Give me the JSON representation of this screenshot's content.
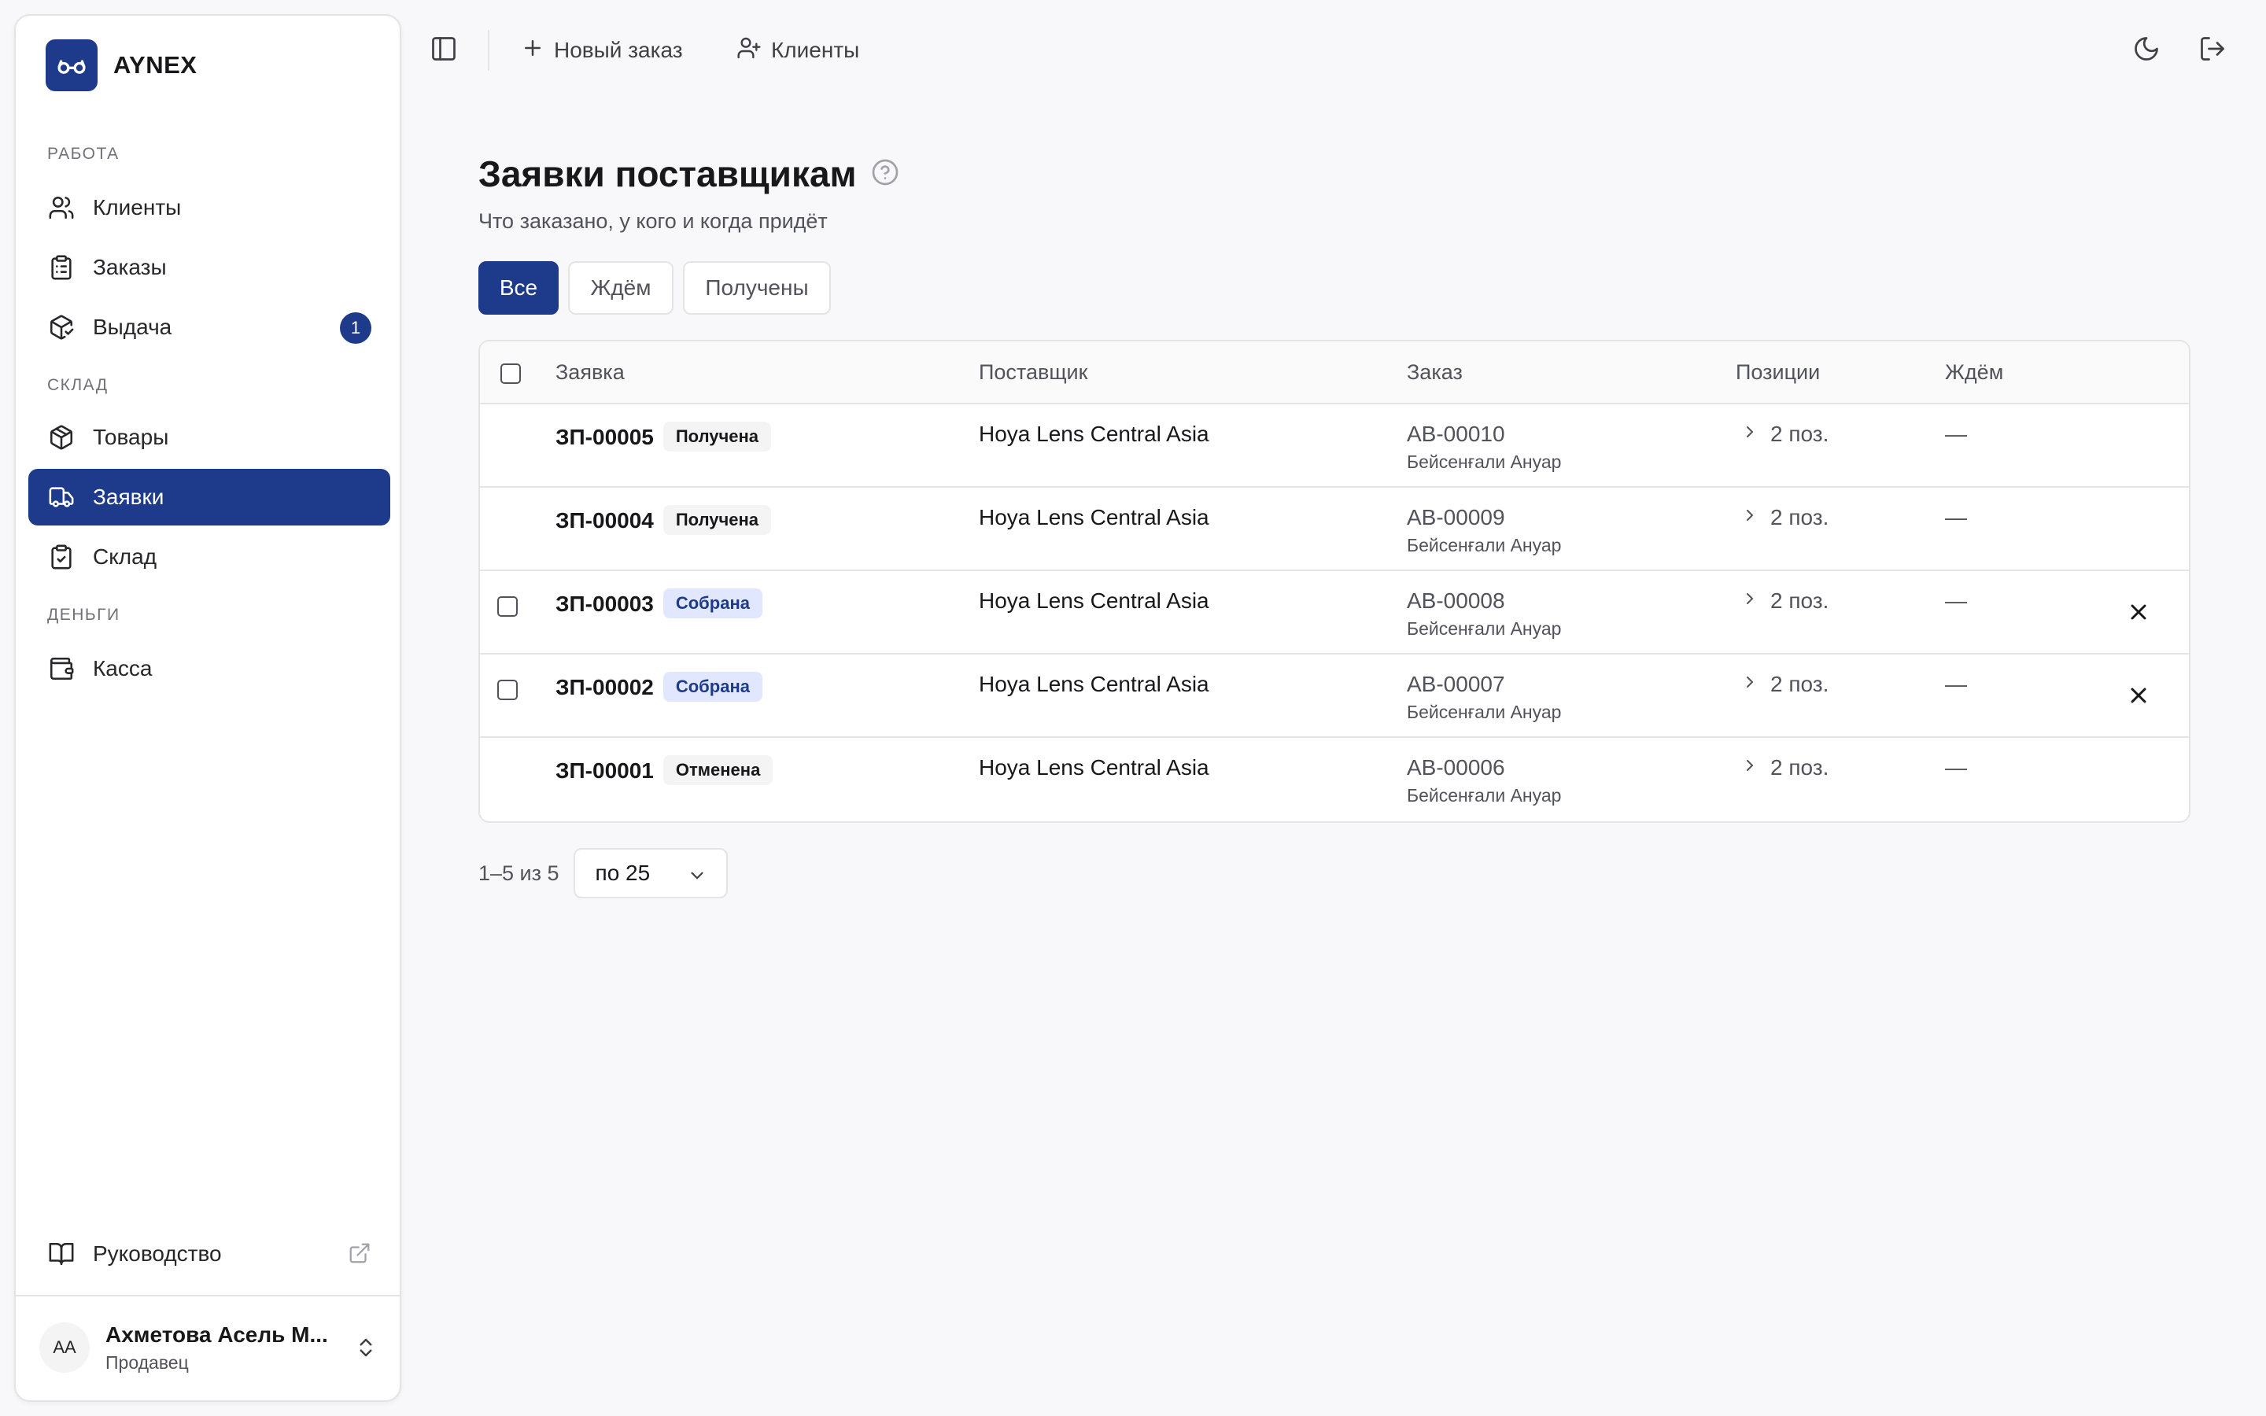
{
  "brand": {
    "name": "AYNEX"
  },
  "sidebar": {
    "sections": [
      {
        "label": "РАБОТА"
      },
      {
        "label": "СКЛАД"
      },
      {
        "label": "ДЕНЬГИ"
      }
    ],
    "items": [
      {
        "label": "Клиенты",
        "icon": "users-icon"
      },
      {
        "label": "Заказы",
        "icon": "clipboard-list-icon"
      },
      {
        "label": "Выдача",
        "icon": "package-check-icon",
        "badge": "1"
      },
      {
        "label": "Товары",
        "icon": "box-icon"
      },
      {
        "label": "Заявки",
        "icon": "truck-icon",
        "active": true
      },
      {
        "label": "Склад",
        "icon": "clipboard-check-icon"
      },
      {
        "label": "Касса",
        "icon": "wallet-icon"
      }
    ],
    "guide": {
      "label": "Руководство"
    },
    "user": {
      "initials": "АА",
      "name": "Ахметова Асель М...",
      "role": "Продавец"
    }
  },
  "topbar": {
    "new_order": "Новый заказ",
    "clients": "Клиенты"
  },
  "page": {
    "title": "Заявки поставщикам",
    "subtitle": "Что заказано, у кого и когда придёт"
  },
  "filters": [
    {
      "label": "Все",
      "active": true
    },
    {
      "label": "Ждём"
    },
    {
      "label": "Получены"
    }
  ],
  "table": {
    "columns": [
      "Заявка",
      "Поставщик",
      "Заказ",
      "Позиции",
      "Ждём"
    ],
    "rows": [
      {
        "id": "ЗП-00005",
        "status": "Получена",
        "supplier": "Hoya Lens Central Asia",
        "order": "АВ-00010",
        "client": "Бейсенғали Ануар",
        "positions": "2 поз.",
        "wait": "—"
      },
      {
        "id": "ЗП-00004",
        "status": "Получена",
        "supplier": "Hoya Lens Central Asia",
        "order": "АВ-00009",
        "client": "Бейсенғали Ануар",
        "positions": "2 поз.",
        "wait": "—"
      },
      {
        "id": "ЗП-00003",
        "status": "Собрана",
        "supplier": "Hoya Lens Central Asia",
        "order": "АВ-00008",
        "client": "Бейсенғали Ануар",
        "positions": "2 поз.",
        "wait": "—"
      },
      {
        "id": "ЗП-00002",
        "status": "Собрана",
        "supplier": "Hoya Lens Central Asia",
        "order": "АВ-00007",
        "client": "Бейсенғали Ануар",
        "positions": "2 поз.",
        "wait": "—"
      },
      {
        "id": "ЗП-00001",
        "status": "Отменена",
        "supplier": "Hoya Lens Central Asia",
        "order": "АВ-00006",
        "client": "Бейсенғали Ануар",
        "positions": "2 поз.",
        "wait": "—"
      }
    ]
  },
  "pager": {
    "count": "1–5 из 5",
    "per_page": "по 25"
  },
  "colors": {
    "accent": "#1e3a8a",
    "border": "#e4e4e7",
    "badge_blue_bg": "#e0e7ff",
    "badge_gray_bg": "#f4f4f5"
  }
}
